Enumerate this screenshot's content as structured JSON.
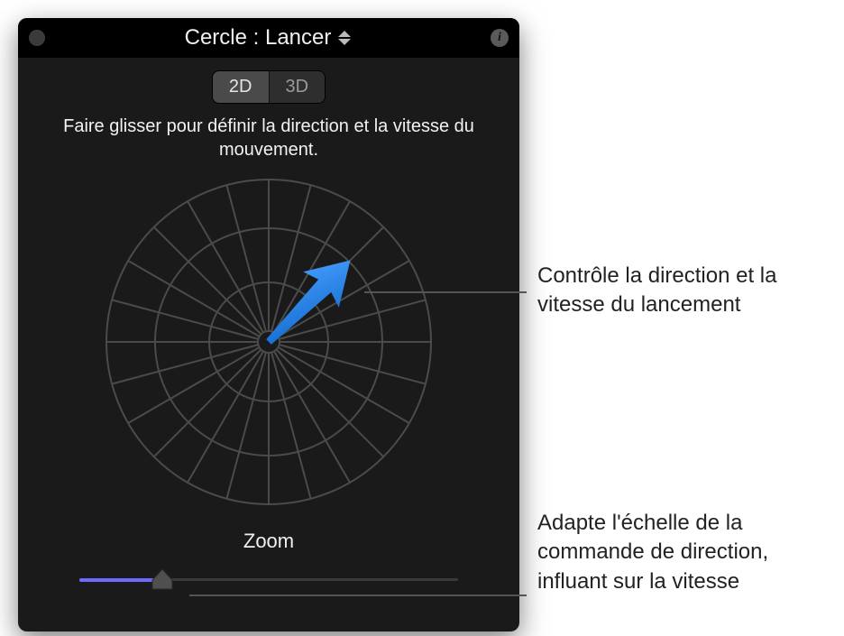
{
  "title": "Cercle : Lancer",
  "mode": {
    "option_a": "2D",
    "option_b": "3D",
    "active": "2D"
  },
  "instruction": "Faire glisser pour définir la direction et la vitesse du mouvement.",
  "radar": {
    "angle_deg": 45,
    "magnitude_pct": 60
  },
  "zoom": {
    "label": "Zoom",
    "value_pct": 22
  },
  "annotations": {
    "direction": "Contrôle la direction et la vitesse du lancement",
    "zoom": "Adapte l'échelle de la commande de direction, influant sur la vitesse"
  }
}
